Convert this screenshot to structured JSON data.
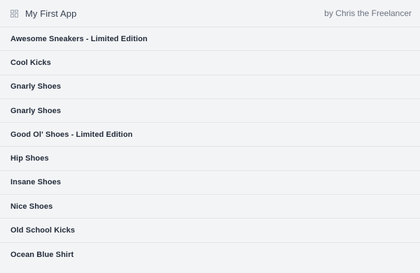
{
  "header": {
    "title": "My First App",
    "byline": "by Chris the Freelancer",
    "icon": "grid-layout-icon"
  },
  "products": [
    {
      "name": "Awesome Sneakers - Limited Edition"
    },
    {
      "name": "Cool Kicks"
    },
    {
      "name": "Gnarly Shoes"
    },
    {
      "name": "Gnarly Shoes"
    },
    {
      "name": "Good Ol' Shoes - Limited Edition"
    },
    {
      "name": "Hip Shoes"
    },
    {
      "name": "Insane Shoes"
    },
    {
      "name": "Nice Shoes"
    },
    {
      "name": "Old School Kicks"
    },
    {
      "name": "Ocean Blue Shirt"
    }
  ],
  "colors": {
    "background": "#f3f4f6",
    "divider": "#e3e5e8",
    "text": "#1f2937",
    "muted": "#6b7280"
  }
}
